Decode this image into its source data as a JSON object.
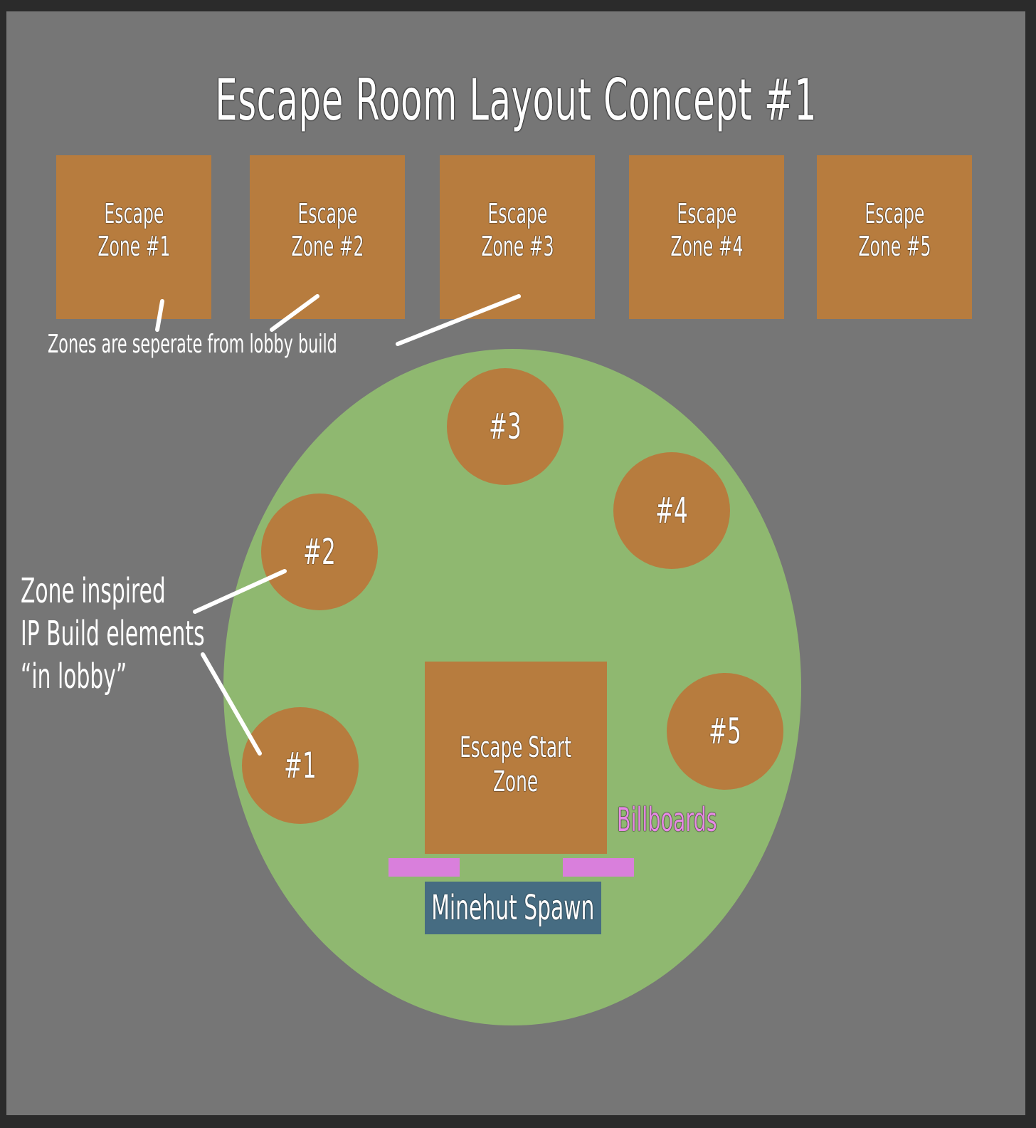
{
  "title": "Escape Room Layout Concept #1",
  "escape_zones": [
    {
      "line1": "Escape",
      "line2": "Zone #1"
    },
    {
      "line1": "Escape",
      "line2": "Zone #2"
    },
    {
      "line1": "Escape",
      "line2": "Zone #3"
    },
    {
      "line1": "Escape",
      "line2": "Zone #4"
    },
    {
      "line1": "Escape",
      "line2": "Zone #5"
    }
  ],
  "zones_note": "Zones are seperate from lobby build",
  "lobby_elements": [
    "#1",
    "#2",
    "#3",
    "#4",
    "#5"
  ],
  "side_note": {
    "line1": "Zone inspired",
    "line2": "IP Build elements",
    "line3": "“in lobby”"
  },
  "start_zone": {
    "line1": "Escape Start",
    "line2": "Zone"
  },
  "billboards_label": "Billboards",
  "spawn_label": "Minehut Spawn",
  "colors": {
    "background": "#767676",
    "zone_fill": "#b77c3e",
    "lobby_fill": "#8fb870",
    "billboard_fill": "#d97fdc",
    "spawn_fill": "#466c82"
  }
}
